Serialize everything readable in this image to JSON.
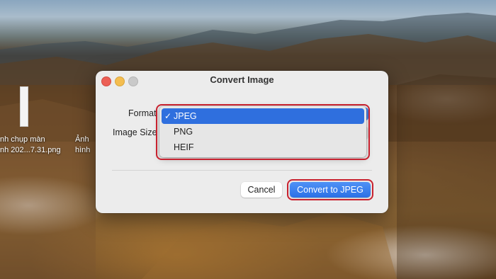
{
  "desktop": {
    "icon_label_line1": "nh chụp màn",
    "icon_label_line2": "nh 202...7.31.png",
    "icon2_label_line1": "Ảnh",
    "icon2_label_line2": "hình"
  },
  "dialog": {
    "title": "Convert Image",
    "format_label": "Format",
    "size_label": "Image Size",
    "format_options": [
      "JPEG",
      "PNG",
      "HEIF"
    ],
    "selected_format": "JPEG",
    "check_mark": "✓",
    "cancel_label": "Cancel",
    "convert_label": "Convert to JPEG"
  },
  "colors": {
    "accent": "#2f6fde",
    "highlight": "#c8222f",
    "close": "#ec5f55",
    "minimize": "#f4bd4f"
  },
  "icons": {
    "close": "close-icon",
    "minimize": "minimize-icon",
    "maximize": "maximize-icon",
    "check": "checkmark-icon"
  }
}
